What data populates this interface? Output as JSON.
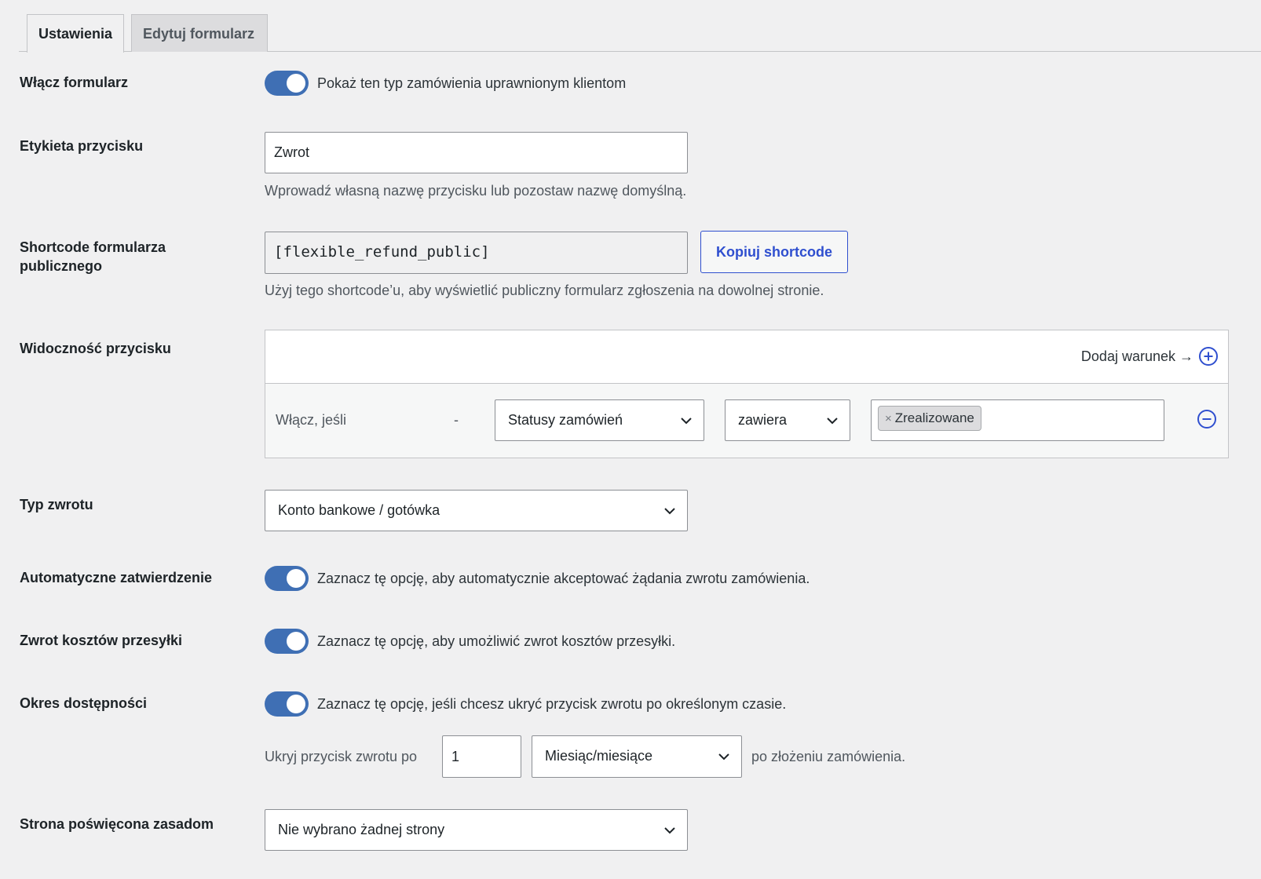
{
  "tabs": [
    {
      "label": "Ustawienia",
      "active": true
    },
    {
      "label": "Edytuj formularz",
      "active": false
    }
  ],
  "enable_form": {
    "label": "Włącz formularz",
    "toggle_on": true,
    "description": "Pokaż ten typ zamówienia uprawnionym klientom"
  },
  "button_label": {
    "label": "Etykieta przycisku",
    "value": "Zwrot",
    "description": "Wprowadź własną nazwę przycisku lub pozostaw nazwę domyślną."
  },
  "shortcode": {
    "label_line1": "Shortcode formularza",
    "label_line2": "publicznego",
    "value": "[flexible_refund_public]",
    "copy_button": "Kopiuj shortcode",
    "description": "Użyj tego shortcode’u, aby wyświetlić publiczny formularz zgłoszenia na dowolnej stronie."
  },
  "visibility": {
    "label": "Widoczność przycisku",
    "add_condition": "Dodaj warunek →",
    "condition": {
      "prefix": "Włącz, jeśli",
      "dash": "-",
      "field": "Statusy zamówień",
      "operator": "zawiera",
      "tokens": [
        "Zrealizowane"
      ],
      "token_remove": "×"
    }
  },
  "refund_type": {
    "label": "Typ zwrotu",
    "value": "Konto bankowe / gotówka"
  },
  "auto_approve": {
    "label": "Automatyczne zatwierdzenie",
    "toggle_on": true,
    "description": "Zaznacz tę opcję, aby automatycznie akceptować żądania zwrotu zamówienia."
  },
  "shipping_refund": {
    "label": "Zwrot kosztów przesyłki",
    "toggle_on": true,
    "description": "Zaznacz tę opcję, aby umożliwić zwrot kosztów przesyłki."
  },
  "availability": {
    "label": "Okres dostępności",
    "toggle_on": true,
    "description": "Zaznacz tę opcję, jeśli chcesz ukryć przycisk zwrotu po określonym czasie.",
    "hide_prefix": "Ukryj przycisk zwrotu po",
    "period_value": "1",
    "period_unit": "Miesiąc/miesiące",
    "hide_suffix": "po złożeniu zamówienia."
  },
  "policy_page": {
    "label": "Strona poświęcona zasadom",
    "value": "Nie wybrano żadnej strony"
  },
  "colors": {
    "toggle_on": "#3f6fb4",
    "accent": "#2f4fcf",
    "background": "#f0f0f1"
  }
}
